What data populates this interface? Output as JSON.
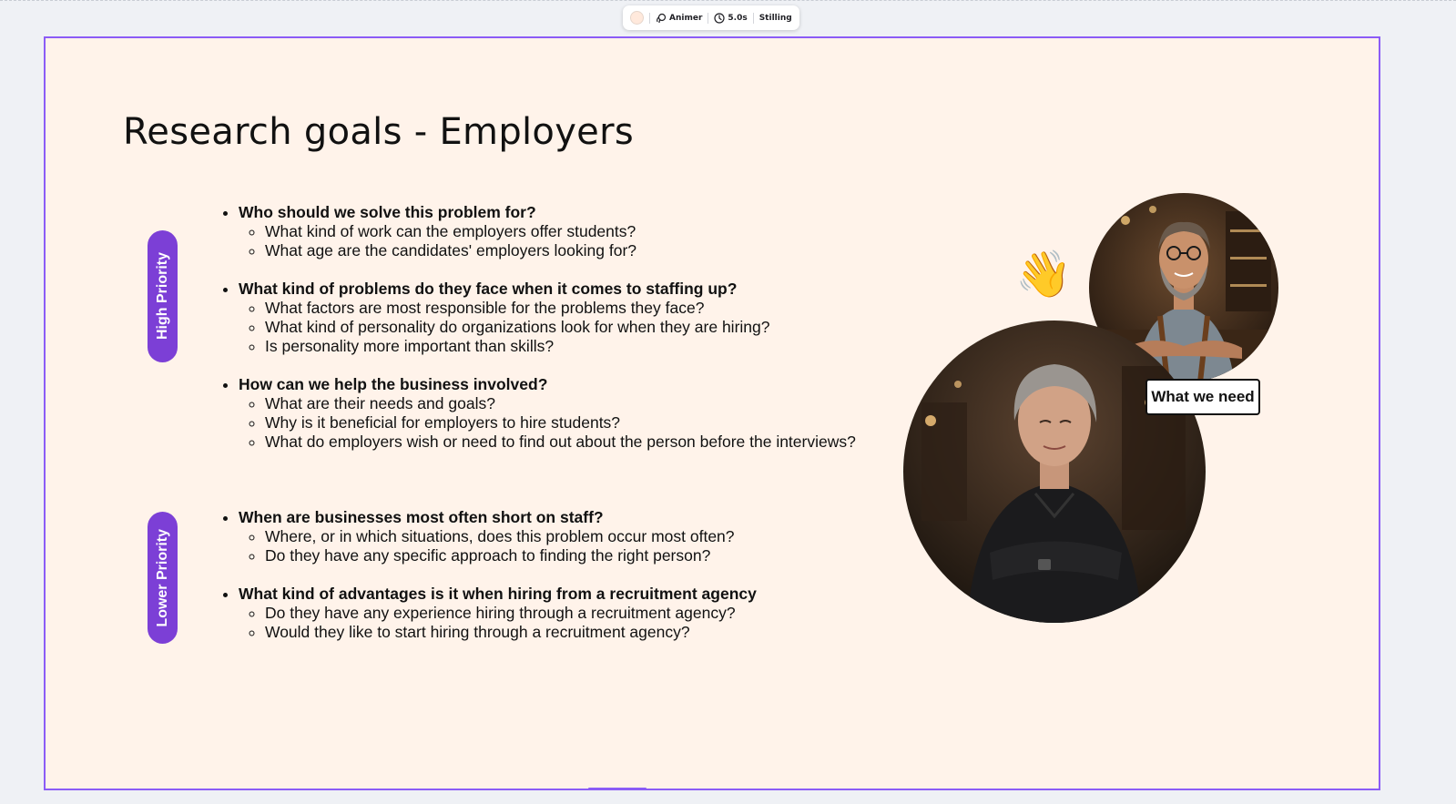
{
  "toolbar": {
    "animate_label": "Animer",
    "duration_label": "5.0s",
    "position_label": "Stilling"
  },
  "slide": {
    "title": "Research goals - Employers",
    "high_priority_label": "High Priority",
    "lower_priority_label": "Lower Priority",
    "high_priority_questions": [
      {
        "heading": "Who should we solve this problem for?",
        "subs": [
          "What kind of work can the employers offer students?",
          "What age are the candidates' employers looking for?"
        ]
      },
      {
        "heading": "What kind of problems do they face when it comes to staffing up?",
        "subs": [
          "What factors are most responsible for the problems they face?",
          "What kind of personality do organizations look for when they are hiring?",
          "Is personality more important than skills?"
        ]
      },
      {
        "heading": "How can we help the business involved?",
        "subs": [
          "What are their needs and goals?",
          "Why is it beneficial for employers to hire students?",
          "What do employers wish or need to find out about the person before the interviews?"
        ]
      }
    ],
    "lower_priority_questions": [
      {
        "heading": "When are businesses most often short on staff?",
        "subs": [
          "Where, or in which situations, does this problem occur most often?",
          "Do they have any specific approach to finding the right person?"
        ]
      },
      {
        "heading": "What kind of advantages is it when hiring from a recruitment agency",
        "subs": [
          "Do they have any experience hiring through a recruitment agency?",
          "Would they like to start hiring through a recruitment agency?"
        ]
      }
    ],
    "wave_emoji": "👋",
    "tag_label": "What we need"
  },
  "colors": {
    "slide_background": "#fff3ea",
    "selection_border": "#8b5cf6",
    "pill": "#7c3fd6"
  }
}
